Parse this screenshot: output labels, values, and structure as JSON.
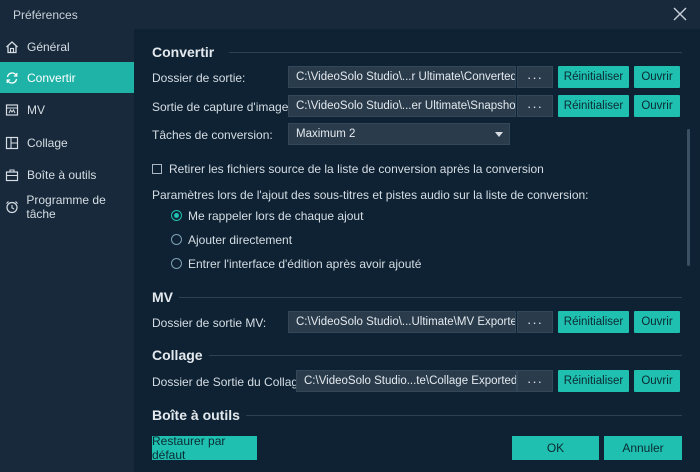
{
  "window": {
    "title": "Préférences"
  },
  "sidebar": {
    "items": [
      {
        "label": "Général",
        "icon": "home-icon"
      },
      {
        "label": "Convertir",
        "icon": "refresh-icon",
        "active": true
      },
      {
        "label": "MV",
        "icon": "mv-icon"
      },
      {
        "label": "Collage",
        "icon": "collage-icon"
      },
      {
        "label": "Boîte à outils",
        "icon": "toolbox-icon"
      },
      {
        "label": "Programme de tâche",
        "icon": "alarm-clock-icon"
      }
    ]
  },
  "convert": {
    "title": "Convertir",
    "output_folder": {
      "label": "Dossier de sortie:",
      "value": "C:\\VideoSolo Studio\\...r Ultimate\\Converted"
    },
    "snapshot_folder": {
      "label": "Sortie de capture d'image:",
      "value": "C:\\VideoSolo Studio\\...er Ultimate\\Snapshot"
    },
    "tasks": {
      "label": "Tâches de conversion:",
      "value": "Maximum 2"
    },
    "remove_source": {
      "label": "Retirer les fichiers source de la liste de conversion après la conversion",
      "checked": false
    },
    "subtitle_params_label": "Paramètres lors de l'ajout des sous-titres et pistes audio sur la liste de conversion:",
    "radio_options": [
      {
        "label": "Me rappeler lors de chaque ajout",
        "selected": true
      },
      {
        "label": "Ajouter directement",
        "selected": false
      },
      {
        "label": "Entrer l'interface d'édition après avoir ajouté",
        "selected": false
      }
    ]
  },
  "mv": {
    "title": "MV",
    "output_folder": {
      "label": "Dossier de sortie MV:",
      "value": "C:\\VideoSolo Studio\\...Ultimate\\MV Exported"
    }
  },
  "collage": {
    "title": "Collage",
    "output_folder": {
      "label": "Dossier de Sortie du Collage:",
      "value": "C:\\VideoSolo Studio...te\\Collage Exported"
    }
  },
  "toolbox": {
    "title": "Boîte à outils"
  },
  "buttons": {
    "dots": "···",
    "reset": "Réinitialiser",
    "open": "Ouvrir",
    "restore_defaults": "Restaurer par défaut",
    "ok": "OK",
    "cancel": "Annuler"
  },
  "colors": {
    "accent": "#1fc0b0",
    "sidebar_active": "#1fb3a8",
    "panel_bg": "#0e2233",
    "sidebar_bg": "#17293a"
  }
}
